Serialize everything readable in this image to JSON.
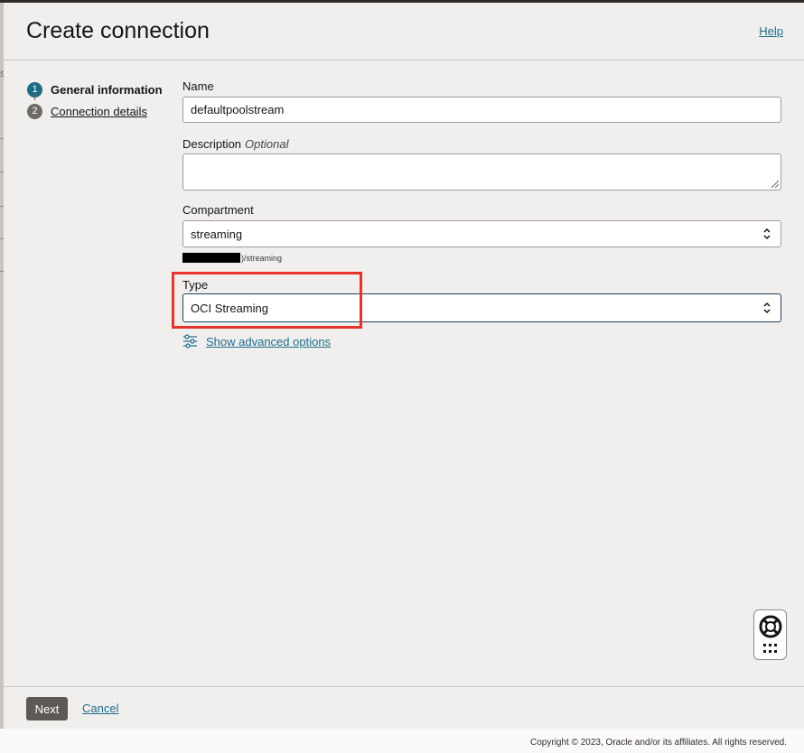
{
  "header": {
    "title": "Create connection",
    "help_label": "Help"
  },
  "steps": [
    {
      "number": "1",
      "label": "General information",
      "state": "active"
    },
    {
      "number": "2",
      "label": "Connection details",
      "state": "pending"
    }
  ],
  "form": {
    "name": {
      "label": "Name",
      "value": "defaultpoolstream"
    },
    "description": {
      "label": "Description",
      "optional_label": "Optional",
      "value": ""
    },
    "compartment": {
      "label": "Compartment",
      "value": "streaming",
      "path_suffix": ")/streaming"
    },
    "type": {
      "label": "Type",
      "value": "OCI Streaming"
    },
    "advanced_options_label": "Show advanced options"
  },
  "highlight_color": "#e8322a",
  "footer": {
    "next_label": "Next",
    "cancel_label": "Cancel"
  },
  "copyright": "Copyright © 2023, Oracle and/or its affiliates. All rights reserved.",
  "icons": {
    "select": "chevron-up-down-icon",
    "advanced": "sliders-icon",
    "help_widget": [
      "life-ring-icon",
      "apps-grid-icon"
    ]
  }
}
